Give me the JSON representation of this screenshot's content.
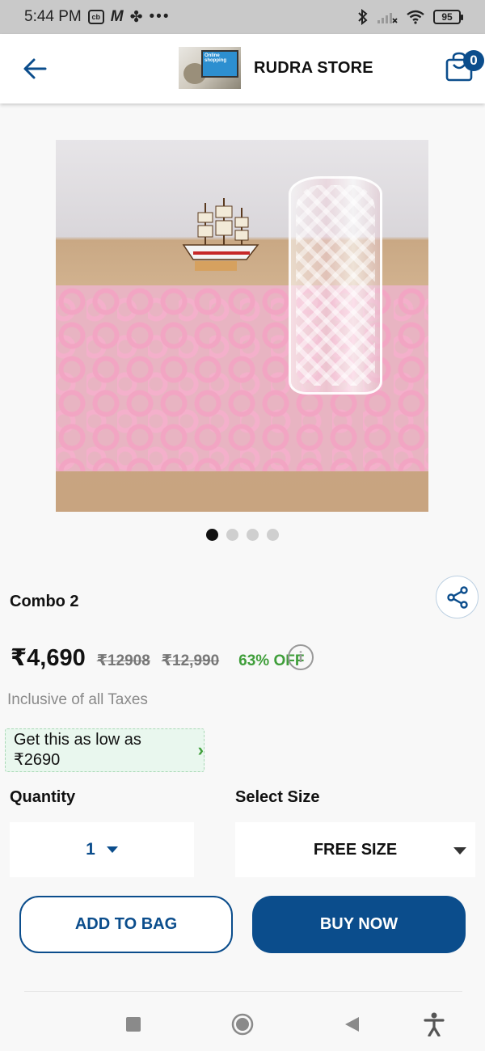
{
  "status_bar": {
    "time": "5:44 PM",
    "icons_left": [
      "cb-icon",
      "m-icon",
      "fan-icon",
      "more-dots-icon"
    ],
    "icons_right": [
      "bluetooth-icon",
      "signal-icon",
      "wifi-icon"
    ],
    "battery": "95"
  },
  "header": {
    "store_name": "RUDRA STORE",
    "logo_caption": "Online shopping",
    "cart_count": "0"
  },
  "gallery": {
    "image_count": 4,
    "active_index": 0
  },
  "product": {
    "title": "Combo 2",
    "price": "₹4,690",
    "mrp_1": "₹12908",
    "mrp_2": "₹12,990",
    "discount": "63% OFF",
    "tax_note": "Inclusive of all Taxes",
    "offer": "Get this as low as ₹2690"
  },
  "options": {
    "quantity_label": "Quantity",
    "quantity_value": "1",
    "size_label": "Select Size",
    "size_value": "FREE SIZE"
  },
  "actions": {
    "add_to_bag": "ADD TO BAG",
    "buy_now": "BUY NOW"
  },
  "colors": {
    "primary": "#0b4d8c",
    "discount_green": "#3f9e3a",
    "offer_bg": "#e9f7ee"
  }
}
